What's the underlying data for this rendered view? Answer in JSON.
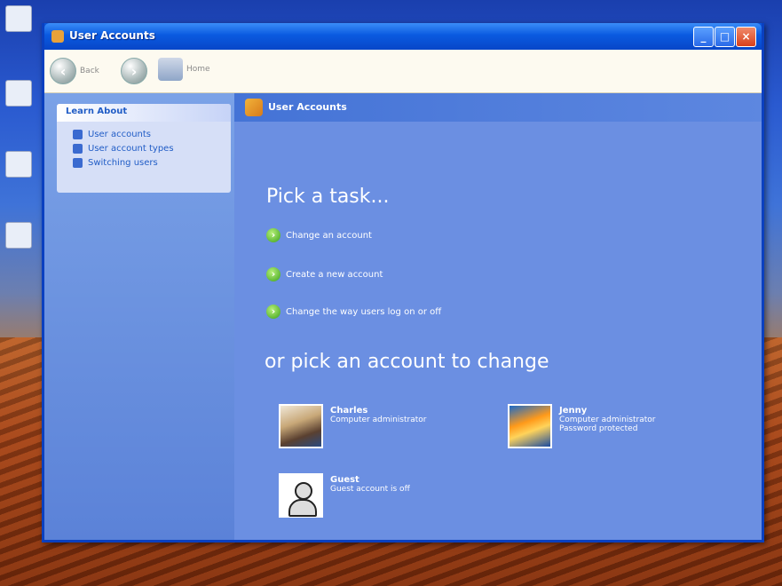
{
  "window": {
    "title": "User Accounts",
    "title_right_text": "",
    "controls": {
      "minimize": "_",
      "maximize": "□",
      "close": "×"
    }
  },
  "toolbar": {
    "back_label": "Back",
    "forward_label": "",
    "home_label": "Home"
  },
  "sidebar": {
    "panel_title": "Learn About",
    "items": [
      {
        "label": "User accounts",
        "icon": "help-icon"
      },
      {
        "label": "User account types",
        "icon": "help-icon"
      },
      {
        "label": "Switching users",
        "icon": "help-icon"
      }
    ]
  },
  "main": {
    "header": "User Accounts",
    "pick_task": "Pick a task...",
    "tasks": [
      {
        "label": "Change an account",
        "icon": "arrow-icon"
      },
      {
        "label": "Create a new account",
        "icon": "arrow-icon"
      },
      {
        "label": "Change the way users log on or off",
        "icon": "arrow-icon"
      }
    ],
    "pick_account": "or pick an account to change",
    "accounts": [
      {
        "name": "Charles",
        "type": "Computer administrator",
        "note": ""
      },
      {
        "name": "Jenny",
        "type": "Computer administrator",
        "note": "Password protected"
      },
      {
        "name": "Guest",
        "type": "Guest account is off",
        "note": ""
      }
    ]
  },
  "credits": {
    "line1": "",
    "line2": ""
  }
}
